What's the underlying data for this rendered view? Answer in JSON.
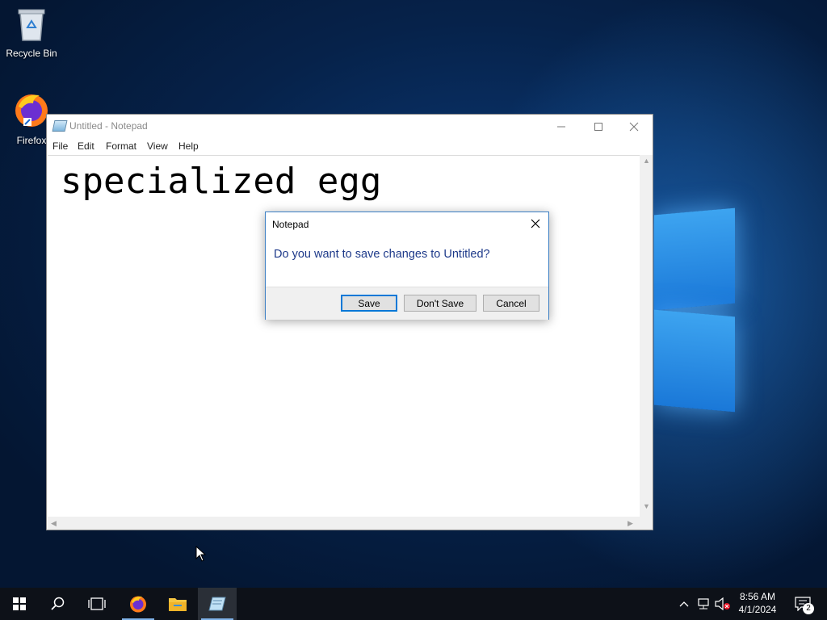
{
  "desktop": {
    "icons": [
      {
        "label": "Recycle Bin",
        "icon": "recycle-bin-icon"
      },
      {
        "label": "Firefox",
        "icon": "firefox-icon"
      }
    ]
  },
  "notepad": {
    "title": "Untitled - Notepad",
    "menu": [
      "File",
      "Edit",
      "Format",
      "View",
      "Help"
    ],
    "content": "specialized egg",
    "controls": {
      "minimize": "minimize-icon",
      "maximize": "maximize-icon",
      "close": "close-icon"
    }
  },
  "dialog": {
    "title": "Notepad",
    "message": "Do you want to save changes to Untitled?",
    "buttons": {
      "save": "Save",
      "dont_save": "Don't Save",
      "cancel": "Cancel"
    },
    "default_button": "Save"
  },
  "taskbar": {
    "items": [
      "start-icon",
      "search-icon",
      "task-view-icon",
      "firefox-icon",
      "file-explorer-icon",
      "notepad-icon"
    ],
    "active_item": "notepad-icon",
    "tray": {
      "icons": [
        "show-hidden-icons-chevron",
        "network-icon",
        "volume-muted-icon"
      ],
      "time": "8:56 AM",
      "date": "4/1/2024",
      "notification_count": "2"
    }
  },
  "colors": {
    "accent": "#0078d7",
    "dialog_text": "#1e3a8a",
    "taskbar": "#0d1118"
  }
}
